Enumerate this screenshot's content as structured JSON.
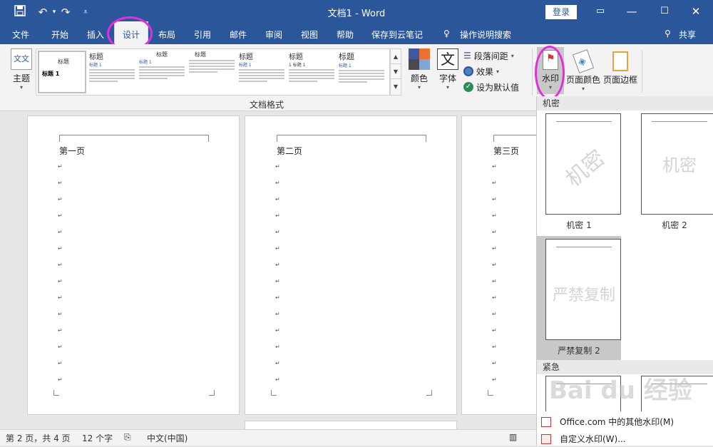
{
  "titlebar": {
    "title": "文档1  -  Word",
    "login": "登录",
    "save_icon": "save-icon",
    "undo_icon": "undo-icon",
    "redo_icon": "redo-icon"
  },
  "menu": {
    "items": [
      "文件",
      "开始",
      "插入",
      "设计",
      "布局",
      "引用",
      "邮件",
      "审阅",
      "视图",
      "帮助",
      "保存到云笔记",
      "操作说明搜索"
    ],
    "active": "设计",
    "share": "共享"
  },
  "ribbon": {
    "theme_label": "主题",
    "theme_icon_text": "文文",
    "style_thumbs": [
      {
        "title": "标题",
        "sub": "标题 1"
      },
      {
        "title": "标题",
        "sub": "标题 1"
      },
      {
        "title": "标题",
        "sub": "标题 1"
      },
      {
        "title": "标题",
        "sub": ""
      },
      {
        "title": "标题",
        "sub": "标题 1"
      },
      {
        "title": "标题",
        "sub": "1 标题 1"
      },
      {
        "title": "标题",
        "sub": "标题 1"
      }
    ],
    "color_label": "颜色",
    "font_label": "字体",
    "font_icon_text": "文",
    "para_spacing": "段落间距",
    "effects": "效果",
    "set_default": "设为默认值",
    "group_label": "文档格式",
    "watermark_label": "水印",
    "page_color_label": "页面颜色",
    "page_border_label": "页面边框"
  },
  "pages": [
    {
      "heading": "第一页"
    },
    {
      "heading": "第二页"
    },
    {
      "heading": "第三页"
    }
  ],
  "statusbar": {
    "page_info": "第 2 页，共 4 页",
    "word_count": "12 个字",
    "language": "中文(中国)"
  },
  "watermark_menu": {
    "section_confidential": "机密",
    "section_urgent": "紧急",
    "items": [
      {
        "caption": "机密 1",
        "text": "机密"
      },
      {
        "caption": "机密 2",
        "text": "机密"
      },
      {
        "caption": "严禁复制 2",
        "text": "严禁复制"
      }
    ],
    "office_more": "Office.com 中的其他水印(M)",
    "custom": "自定义水印(W)..."
  },
  "watermark_overlay": "Bai du 经验",
  "colors": {
    "titlebar_bg": "#2b579a",
    "highlight_circle": "#e22fdc"
  }
}
